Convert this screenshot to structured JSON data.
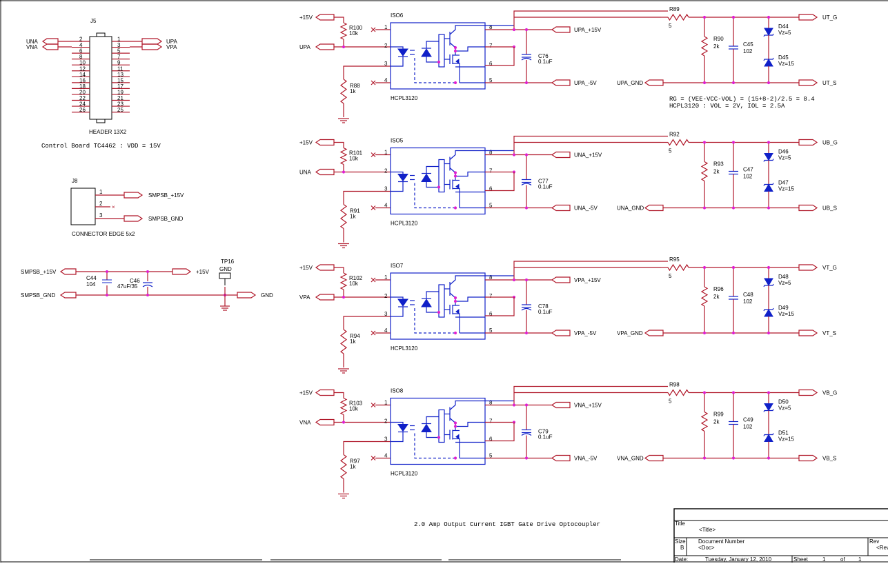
{
  "header": {
    "ref": "J5",
    "name": "HEADER 13X2",
    "left_nets": [
      "UNA",
      "VNA"
    ],
    "right_nets": [
      "UPA",
      "VPA"
    ],
    "left_pins": [
      "2",
      "4",
      "6",
      "8",
      "10",
      "12",
      "14",
      "16",
      "18",
      "20",
      "22",
      "24",
      "26"
    ],
    "right_pins": [
      "1",
      "3",
      "5",
      "7",
      "9",
      "11",
      "13",
      "15",
      "17",
      "19",
      "21",
      "23",
      "25"
    ]
  },
  "note_control": "Control Board TC4462 : VDD = 15V",
  "j8": {
    "ref": "J8",
    "name": "CONNECTOR EDGE 5x2",
    "pins": [
      "1",
      "2",
      "3"
    ],
    "nets": [
      "SMPSB_+15V",
      "SMPSB_GND"
    ]
  },
  "power": {
    "in_pos": "SMPSB_+15V",
    "in_gnd": "SMPSB_GND",
    "c44_ref": "C44",
    "c44_val": "104",
    "c46_ref": "C46",
    "c46_val": "47uF/35",
    "out_pos": "+15V",
    "out_gnd": "GND",
    "tp_ref": "TP16",
    "tp_val": "GND"
  },
  "channels": [
    {
      "vcc": "+15V",
      "in": "UPA",
      "iso": "ISO6",
      "part": "HCPL3120",
      "r_top": "R100",
      "r_top_val": "10k",
      "r_bot": "R88",
      "r_bot_val": "1k",
      "pins": [
        "1",
        "2",
        "3",
        "4",
        "8",
        "7",
        "6",
        "5"
      ],
      "vp": "UPA_+15V",
      "vn": "UPA_-5V",
      "cap": "C76",
      "cap_val": "0.1uF",
      "rg": "R89",
      "rg_val": "5",
      "rs": "R90",
      "rs_val": "2k",
      "cg": "C45",
      "cg_val": "102",
      "z1": "D44",
      "z1_val": "Vz=5",
      "z2": "D45",
      "z2_val": "Vz=15",
      "gnd_in": "UPA_GND",
      "out_g": "UT_G",
      "out_s": "UT_S"
    },
    {
      "vcc": "+15V",
      "in": "UNA",
      "iso": "ISO5",
      "part": "HCPL3120",
      "r_top": "R101",
      "r_top_val": "10k",
      "r_bot": "R91",
      "r_bot_val": "1k",
      "pins": [
        "1",
        "2",
        "3",
        "4",
        "8",
        "7",
        "6",
        "5"
      ],
      "vp": "UNA_+15V",
      "vn": "UNA_-5V",
      "cap": "C77",
      "cap_val": "0.1uF",
      "rg": "R92",
      "rg_val": "5",
      "rs": "R93",
      "rs_val": "2k",
      "cg": "C47",
      "cg_val": "102",
      "z1": "D46",
      "z1_val": "Vz=5",
      "z2": "D47",
      "z2_val": "Vz=15",
      "gnd_in": "UNA_GND",
      "out_g": "UB_G",
      "out_s": "UB_S"
    },
    {
      "vcc": "+15V",
      "in": "VPA",
      "iso": "ISO7",
      "part": "HCPL3120",
      "r_top": "R102",
      "r_top_val": "10k",
      "r_bot": "R94",
      "r_bot_val": "1k",
      "pins": [
        "1",
        "2",
        "3",
        "4",
        "8",
        "7",
        "6",
        "5"
      ],
      "vp": "VPA_+15V",
      "vn": "VPA_-5V",
      "cap": "C78",
      "cap_val": "0.1uF",
      "rg": "R95",
      "rg_val": "5",
      "rs": "R96",
      "rs_val": "2k",
      "cg": "C48",
      "cg_val": "102",
      "z1": "D48",
      "z1_val": "Vz=5",
      "z2": "D49",
      "z2_val": "Vz=15",
      "gnd_in": "VPA_GND",
      "out_g": "VT_G",
      "out_s": "VT_S"
    },
    {
      "vcc": "+15V",
      "in": "VNA",
      "iso": "ISO8",
      "part": "HCPL3120",
      "r_top": "R103",
      "r_top_val": "10k",
      "r_bot": "R97",
      "r_bot_val": "1k",
      "pins": [
        "1",
        "2",
        "3",
        "4",
        "8",
        "7",
        "6",
        "5"
      ],
      "vp": "VNA_+15V",
      "vn": "VNA_-5V",
      "cap": "C79",
      "cap_val": "0.1uF",
      "rg": "R98",
      "rg_val": "5",
      "rs": "R99",
      "rs_val": "2k",
      "cg": "C49",
      "cg_val": "102",
      "z1": "D50",
      "z1_val": "Vz=5",
      "z2": "D51",
      "z2_val": "Vz=15",
      "gnd_in": "VNA_GND",
      "out_g": "VB_G",
      "out_s": "VB_S"
    }
  ],
  "rg_note_1": "RG = (VEE-VCC-VOL) = (15+8-2)/2.5 = 8.4",
  "rg_note_2": "HCPL3120 : VOL = 2V, IOL = 2.5A",
  "caption": "2.0 Amp Output Current IGBT Gate Drive Optocoupler",
  "title_block": {
    "title_label": "Title",
    "title_value": "<Title>",
    "size_label": "Size",
    "size_value": "B",
    "docnum_label": "Document Number",
    "docnum_value": "<Doc>",
    "rev_label": "Rev",
    "rev_value": "<Rev",
    "date_label": "Date:",
    "date_value": "Tuesday, January 12, 2010",
    "sheet_label": "Sheet",
    "sheet_value": "1",
    "of_label": "of",
    "of_value": "1"
  }
}
